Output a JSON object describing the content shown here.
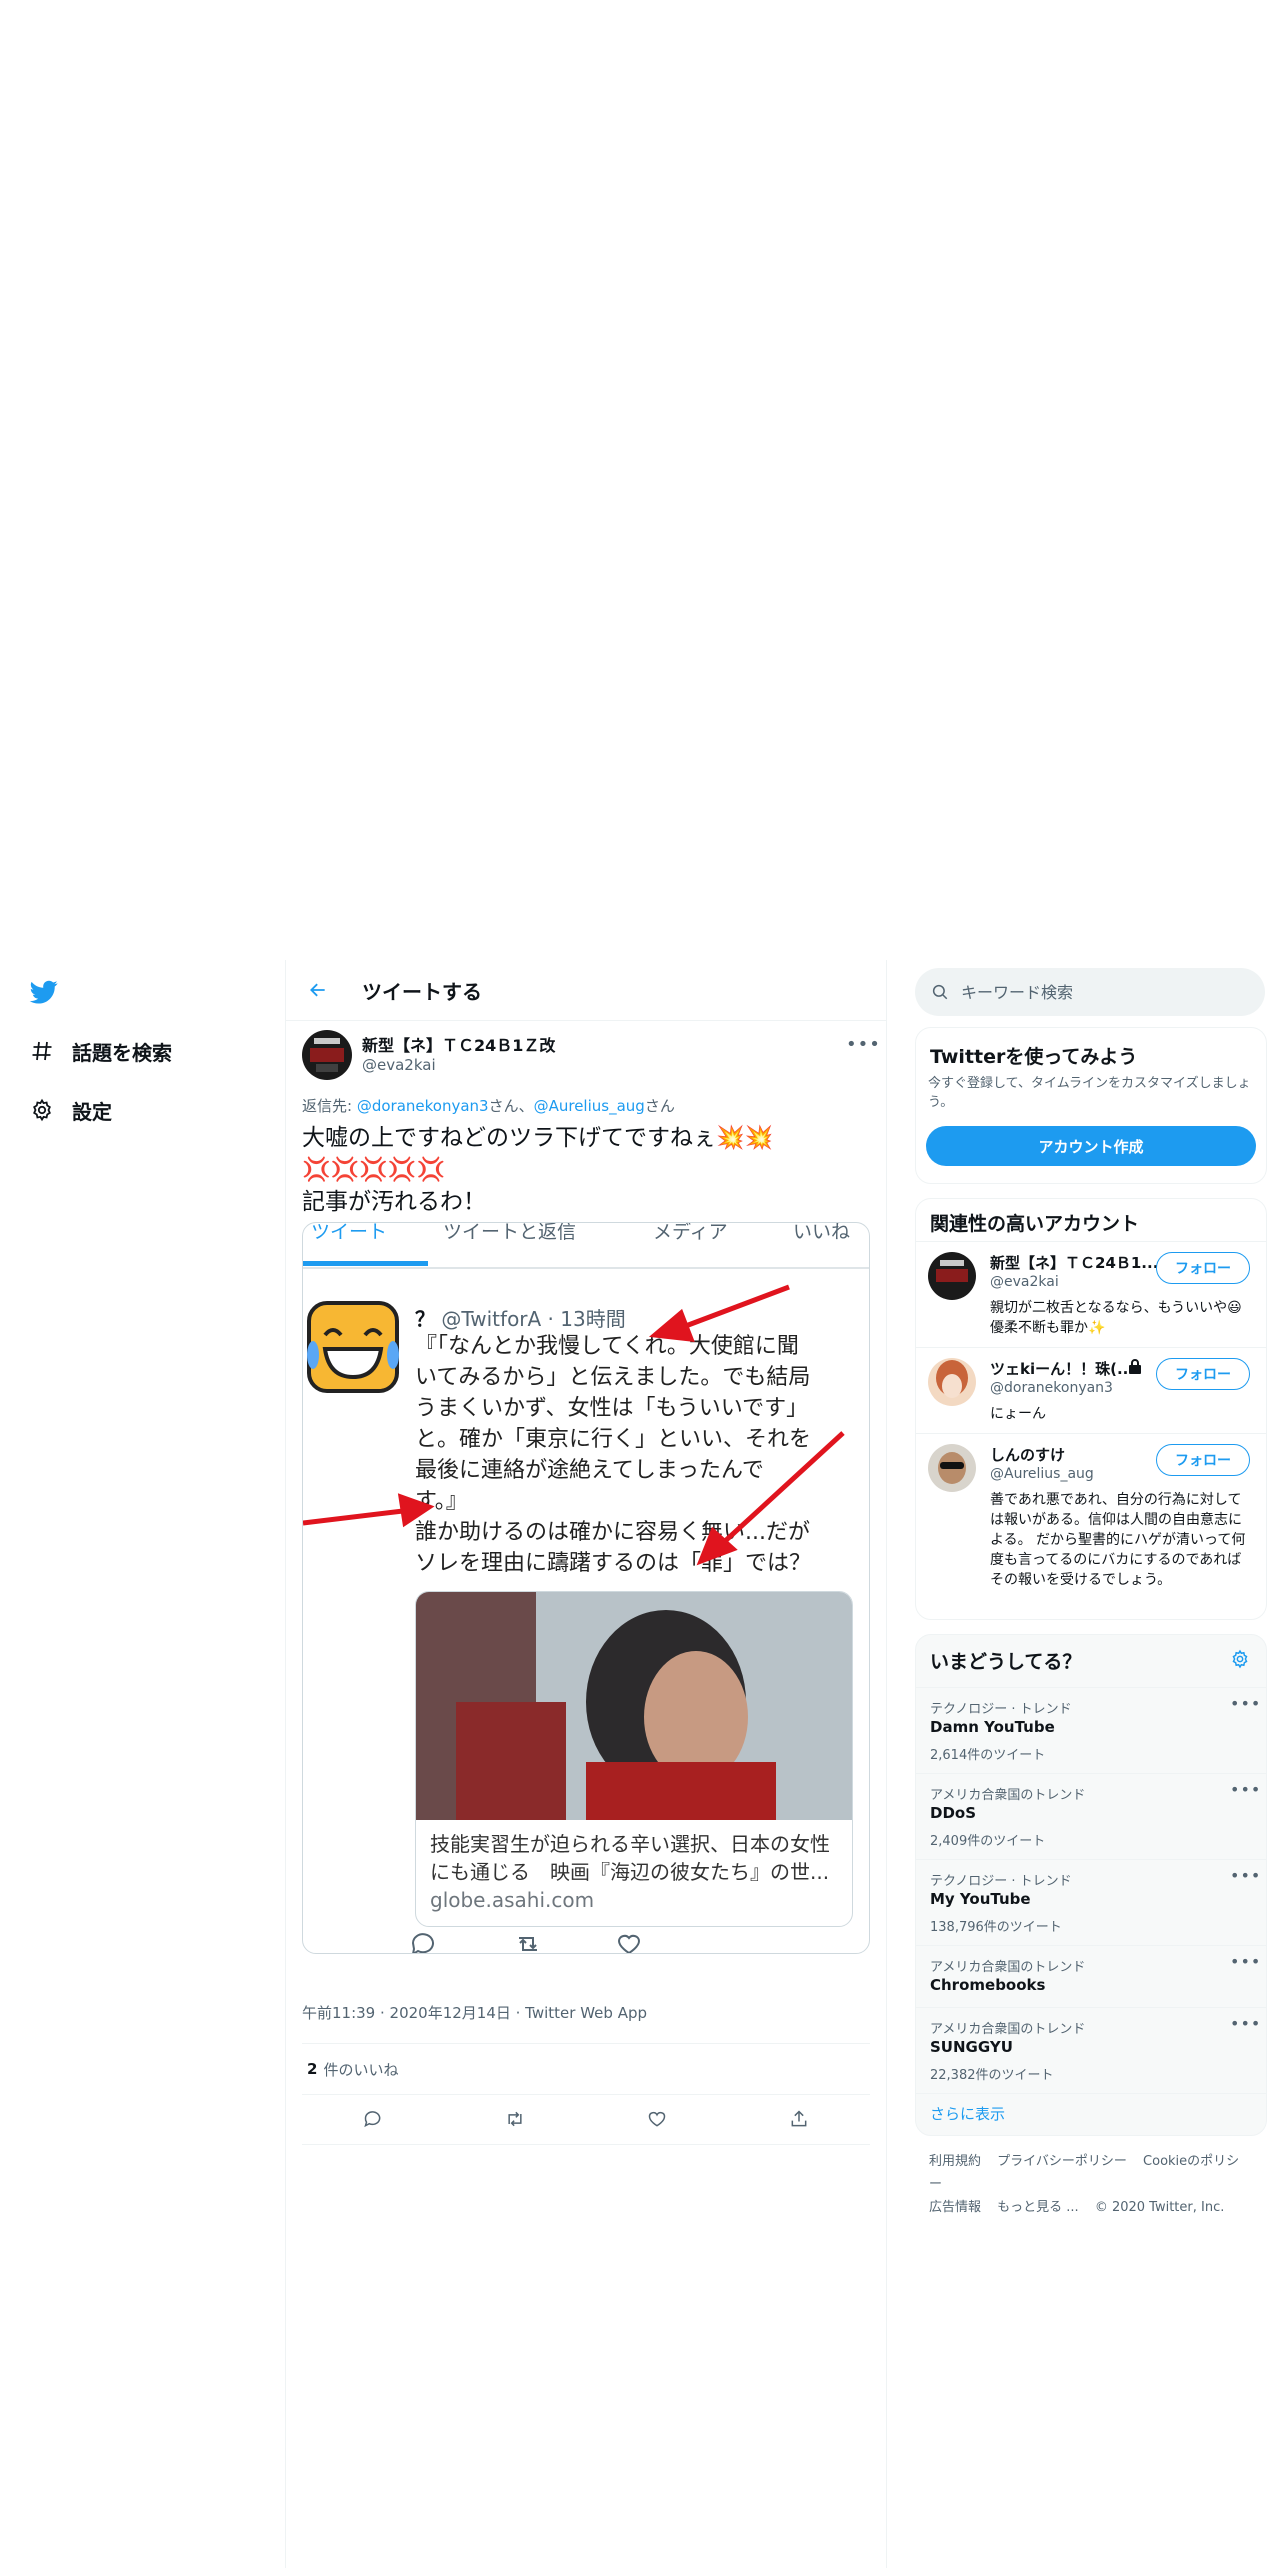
{
  "nav": {
    "explore_label": "話題を検索",
    "settings_label": "設定"
  },
  "header": {
    "title": "ツイートする"
  },
  "tweet": {
    "author_name": "新型【ネ】ＴＣ24Ｂ1Ｚ改",
    "author_handle": "@eva2kai",
    "reply_prefix": "返信先: ",
    "reply_user1": "@doranekonyan3",
    "reply_suffix1": "さん、",
    "reply_user2": "@Aurelius_aug",
    "reply_suffix2": "さん",
    "text_line1": "大嘘の上ですねどのツラ下げてですねぇ💥💥💢💢💢💢💢",
    "text_line2": "記事が汚れるわ！",
    "timestamp": "午前11:39 · 2020年12月14日 · Twitter Web App",
    "likes_count": "2",
    "likes_label": "件のいいね"
  },
  "embedded_screenshot": {
    "tabs": [
      "ツイート",
      "ツイートと返信",
      "メディア",
      "いいね"
    ],
    "inner_author": "？",
    "inner_handle": "@TwitforA · 13時間",
    "inner_text_1": "『「なんとか我慢してくれ。大使館に聞",
    "inner_text_2": "いてみるから」と伝えました。でも結局",
    "inner_text_3": "うまくいかず、女性は「もういいです」",
    "inner_text_4": "と。確か「東京に行く」といい、それを",
    "inner_text_5": "最後に連絡が途絶えてしまったんで",
    "inner_text_6": "す。』",
    "inner_text_7": "誰か助けるのは確かに容易く無い...だが",
    "inner_text_8": "ソレを理由に躊躇するのは「罪」では？",
    "card_title_1": "技能実習生が迫られる辛い選択、日本の女性",
    "card_title_2": "にも通じる　映画『海辺の彼女たち』の世...",
    "card_domain": "globe.asahi.com"
  },
  "search": {
    "placeholder": "キーワード検索"
  },
  "signup": {
    "title": "Twitterを使ってみよう",
    "description": "今すぐ登録して、タイムラインをカスタマイズしましょう。",
    "button": "アカウント作成"
  },
  "related": {
    "title": "関連性の高いアカウント",
    "follow_label": "フォロー",
    "accounts": [
      {
        "name": "新型【ネ】ＴＣ24Ｂ1...",
        "handle": "@eva2kai",
        "bio": "親切が二枚舌となるなら、もういいや😃 優柔不断も罪か✨"
      },
      {
        "name": "ツェkiーん！！珠(...",
        "handle": "@doranekonyan3",
        "bio": "にょーん"
      },
      {
        "name": "しんのすけ",
        "handle": "@Aurelius_aug",
        "bio": "善であれ悪であれ、自分の行為に対しては報いがある。信仰は人間の自由意志による。 だから聖書的にハゲが清いって何度も言ってるのにバカにするのであればその報いを受けるでしょう。"
      }
    ]
  },
  "trends": {
    "title": "いまどうしてる？",
    "items": [
      {
        "context": "テクノロジー · トレンド",
        "name": "Damn YouTube",
        "count": "2,614件のツイート"
      },
      {
        "context": "アメリカ合衆国のトレンド",
        "name": "DDoS",
        "count": "2,409件のツイート"
      },
      {
        "context": "テクノロジー · トレンド",
        "name": "My YouTube",
        "count": "138,796件のツイート"
      },
      {
        "context": "アメリカ合衆国のトレンド",
        "name": "Chromebooks",
        "count": ""
      },
      {
        "context": "アメリカ合衆国のトレンド",
        "name": "SUNGGYU",
        "count": "22,382件のツイート"
      }
    ],
    "show_more": "さらに表示"
  },
  "footer": {
    "terms": "利用規約",
    "privacy": "プライバシーポリシー",
    "cookie": "Cookieのポリシー",
    "ads": "広告情報",
    "more": "もっと見る ...",
    "copyright": "© 2020 Twitter, Inc."
  },
  "colors": {
    "accent": "#1d9bf0",
    "text_primary": "#0f1419",
    "text_secondary": "#536471",
    "border": "#eff3f4"
  }
}
